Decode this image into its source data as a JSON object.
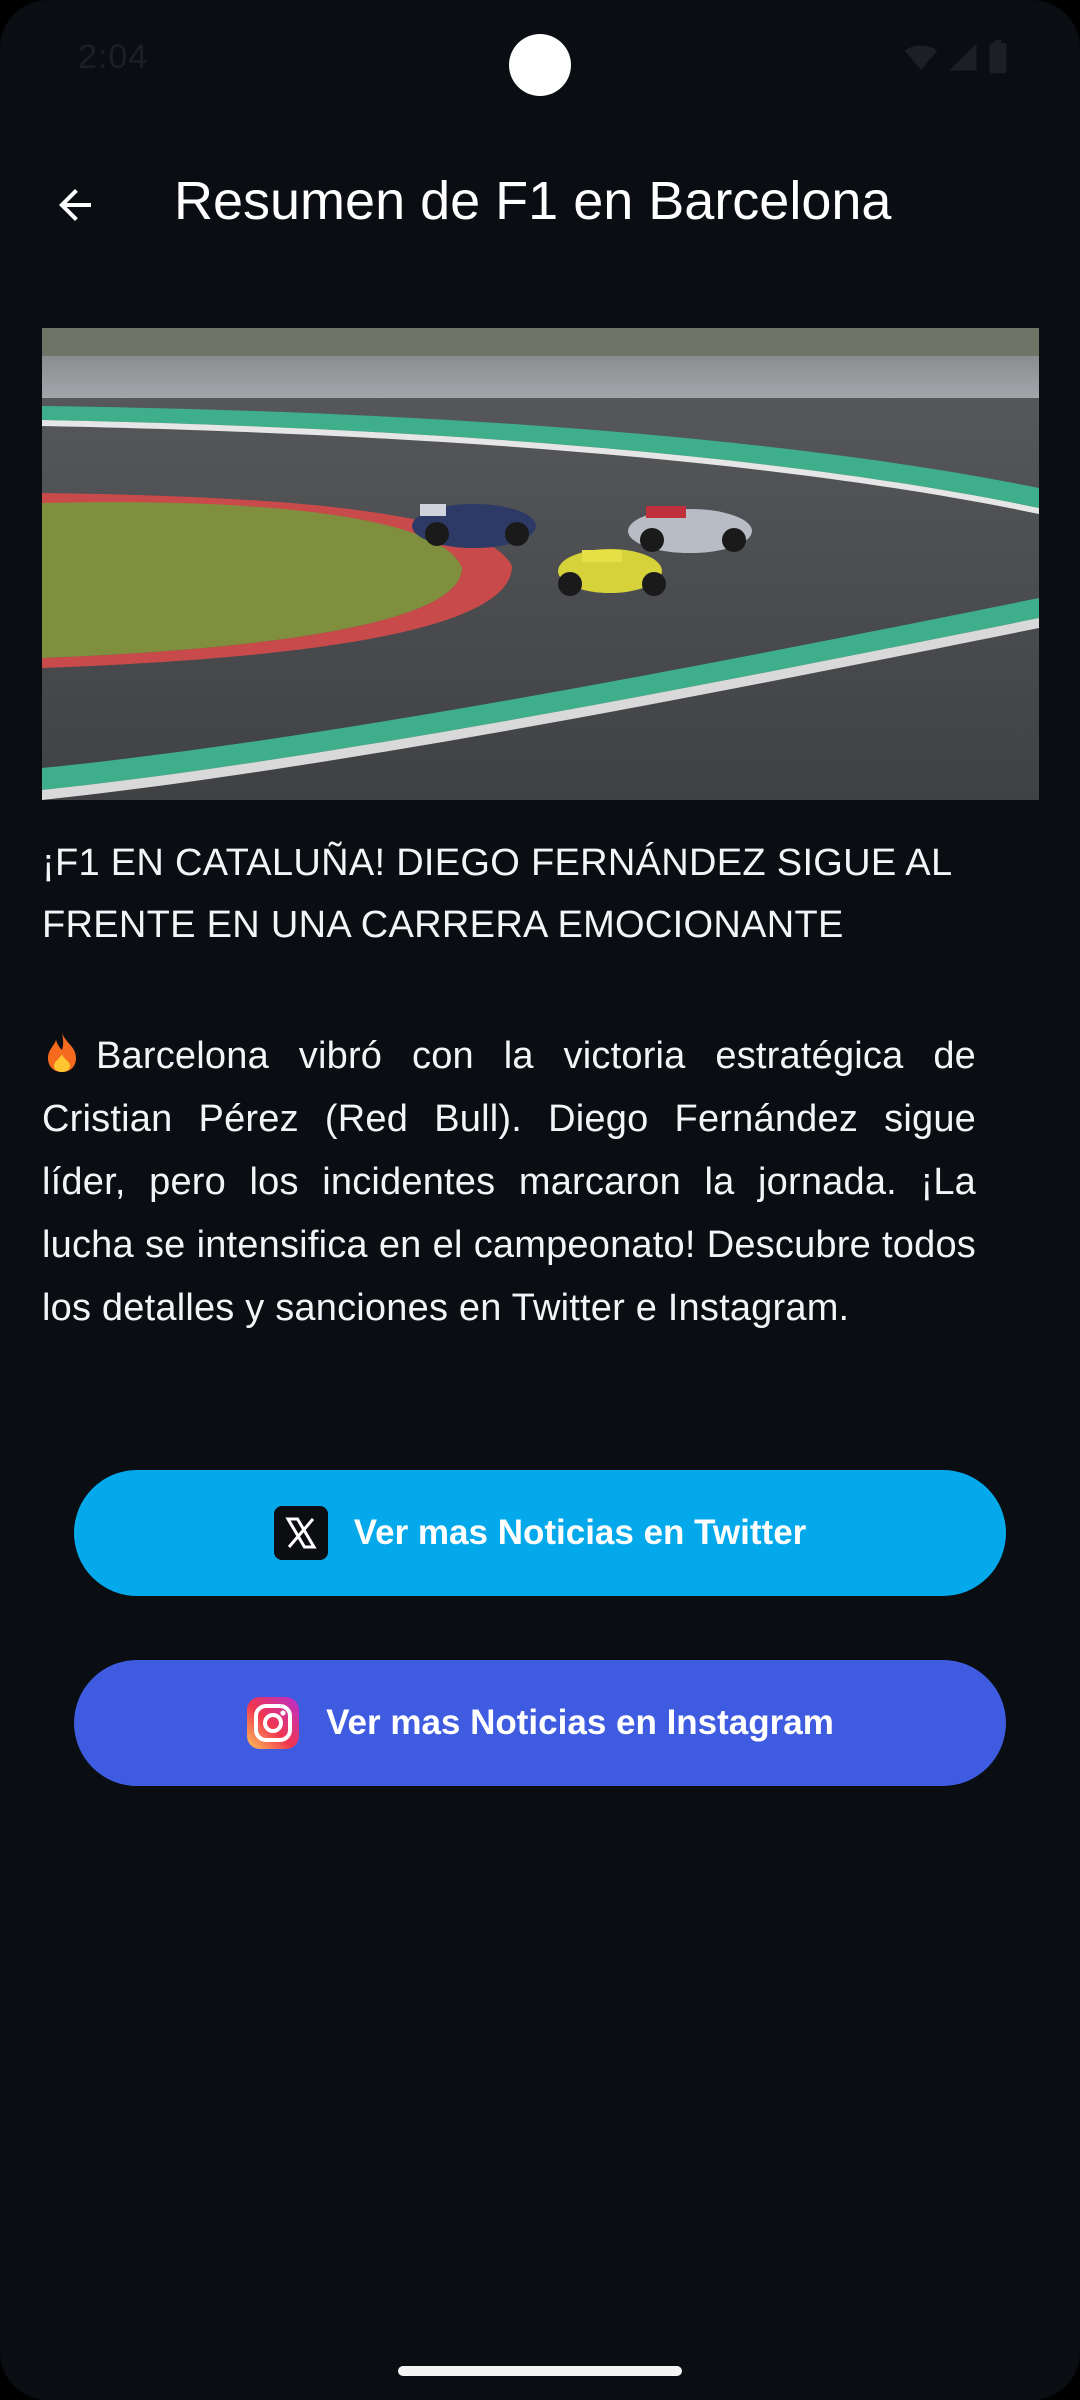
{
  "status_bar": {
    "time": "2:04"
  },
  "app_bar": {
    "title": "Resumen de F1 en Barcelona",
    "back_icon": "arrow-back-icon"
  },
  "hero_image": {
    "description_icon": "race-image"
  },
  "article": {
    "headline": "¡F1 EN CATALUÑA! DIEGO FERNÁNDEZ SIGUE AL FRENTE EN UNA CARRERA EMOCIONANTE",
    "body": "Barcelona vibró con la victoria estratégica de Cristian Pérez (Red Bull). Diego Fernández sigue líder, pero los incidentes marcaron la jornada. ¡La lucha se intensifica en el campeonato! Descubre todos los detalles y sanciones en Twitter e Instagram.",
    "body_icon": "fire-icon"
  },
  "buttons": {
    "twitter_label": "Ver mas Noticias en Twitter",
    "twitter_icon": "x-logo-icon",
    "instagram_label": "Ver mas Noticias en Instagram",
    "instagram_icon": "instagram-logo-icon"
  },
  "colors": {
    "background": "#0a0d11",
    "twitter_button": "#03a9ea",
    "instagram_button": "#3f5be0",
    "text": "#ffffff"
  }
}
